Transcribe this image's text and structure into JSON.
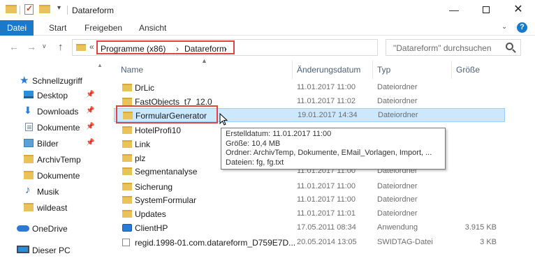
{
  "window": {
    "title": "Datareform",
    "minimize_glyph": "—",
    "maximize_label": "",
    "close_glyph": "✕"
  },
  "ribbon": {
    "tabs": [
      "Datei",
      "Start",
      "Freigeben",
      "Ansicht"
    ],
    "expand_glyph": "⌄",
    "help_glyph": "?"
  },
  "navbar": {
    "back_glyph": "←",
    "forward_glyph": "→",
    "history_glyph": "∨",
    "up_glyph": "↑",
    "overflow_glyph": "«",
    "breadcrumb": [
      "Programme (x86)",
      "Datareform"
    ],
    "breadcrumb_sep": "›",
    "dropdown_glyph": "∨",
    "refresh_glyph": "↻",
    "search_placeholder": "\"Datareform\" durchsuchen"
  },
  "sidebar": {
    "items": [
      {
        "label": "Schnellzugriff",
        "icon": "star-icon",
        "pinned": false
      },
      {
        "label": "Desktop",
        "icon": "desktop-icon",
        "pinned": true
      },
      {
        "label": "Downloads",
        "icon": "download-icon",
        "pinned": true
      },
      {
        "label": "Dokumente",
        "icon": "documents-icon",
        "pinned": true
      },
      {
        "label": "Bilder",
        "icon": "pictures-icon",
        "pinned": true
      },
      {
        "label": "ArchivTemp",
        "icon": "folder-icon",
        "pinned": false
      },
      {
        "label": "Dokumente",
        "icon": "folder-icon",
        "pinned": false
      },
      {
        "label": "Musik",
        "icon": "music-icon",
        "pinned": false
      },
      {
        "label": "wildeast",
        "icon": "folder-icon",
        "pinned": false
      },
      {
        "label": "OneDrive",
        "icon": "cloud-icon",
        "pinned": false
      },
      {
        "label": "Dieser PC",
        "icon": "pc-icon",
        "pinned": false
      }
    ],
    "pin_glyph": "📌"
  },
  "columns": {
    "name": "Name",
    "date": "Änderungsdatum",
    "type": "Typ",
    "size": "Größe"
  },
  "files": [
    {
      "name": "DrLic",
      "date": "11.01.2017 11:00",
      "type": "Dateiordner",
      "size": "",
      "icon": "folder-icon",
      "selected": false
    },
    {
      "name": "FastObjects_t7_12.0",
      "date": "11.01.2017 11:02",
      "type": "Dateiordner",
      "size": "",
      "icon": "folder-icon",
      "selected": false
    },
    {
      "name": "FormularGenerator",
      "date": "19.01.2017 14:34",
      "type": "Dateiordner",
      "size": "",
      "icon": "folder-icon",
      "selected": true
    },
    {
      "name": "HotelProfi10",
      "date": "",
      "type": "",
      "size": "",
      "icon": "folder-icon",
      "selected": false
    },
    {
      "name": "Link",
      "date": "",
      "type": "",
      "size": "",
      "icon": "folder-icon",
      "selected": false
    },
    {
      "name": "plz",
      "date": "",
      "type": "",
      "size": "",
      "icon": "folder-icon",
      "selected": false
    },
    {
      "name": "Segmentanalyse",
      "date": "11.01.2017 11:00",
      "type": "Dateiordner",
      "size": "",
      "icon": "folder-icon",
      "selected": false
    },
    {
      "name": "Sicherung",
      "date": "11.01.2017 11:00",
      "type": "Dateiordner",
      "size": "",
      "icon": "folder-icon",
      "selected": false
    },
    {
      "name": "SystemFormular",
      "date": "11.01.2017 11:00",
      "type": "Dateiordner",
      "size": "",
      "icon": "folder-icon",
      "selected": false
    },
    {
      "name": "Updates",
      "date": "11.01.2017 11:01",
      "type": "Dateiordner",
      "size": "",
      "icon": "folder-icon",
      "selected": false
    },
    {
      "name": "ClientHP",
      "date": "17.05.2011 08:34",
      "type": "Anwendung",
      "size": "3.915 KB",
      "icon": "app-icon",
      "selected": false
    },
    {
      "name": "regid.1998-01.com.datareform_D759E7D...",
      "date": "20.05.2014 13:05",
      "type": "SWIDTAG-Datei",
      "size": "3 KB",
      "icon": "file-icon",
      "selected": false
    }
  ],
  "tooltip": {
    "lines": [
      "Erstelldatum: 11.01.2017 11:00",
      "Größe: 10,4 MB",
      "Ordner: ArchivTemp, Dokumente, EMail_Vorlagen, Import, ...",
      "Dateien: fg, fg.txt"
    ]
  },
  "colors": {
    "accent": "#1979ca",
    "highlight_box": "#e0443e",
    "selection_bg": "#cce8ff",
    "folder": "#e8c35a"
  }
}
